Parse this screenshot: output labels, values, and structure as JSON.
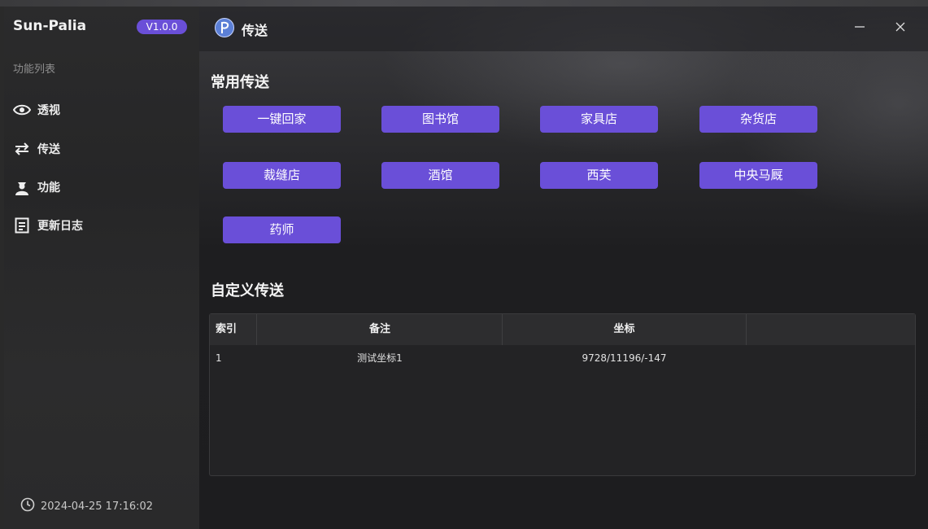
{
  "app": {
    "name": "Sun-Palia",
    "version": "V1.0.0"
  },
  "sidebar": {
    "section_label": "功能列表",
    "items": [
      {
        "label": "透视",
        "icon": "eye-icon"
      },
      {
        "label": "传送",
        "icon": "swap-arrows-icon"
      },
      {
        "label": "功能",
        "icon": "person-icon"
      },
      {
        "label": "更新日志",
        "icon": "document-icon"
      }
    ],
    "clock": "2024-04-25 17:16:02"
  },
  "header": {
    "title": "传送",
    "logo_icon": "palia-logo-icon"
  },
  "common_teleport": {
    "heading": "常用传送",
    "buttons": [
      "一键回家",
      "图书馆",
      "家具店",
      "杂货店",
      "裁缝店",
      "酒馆",
      "西芙",
      "中央马厩",
      "药师"
    ]
  },
  "custom_teleport": {
    "heading": "自定义传送",
    "columns": [
      "索引",
      "备注",
      "坐标",
      ""
    ],
    "rows": [
      {
        "index": "1",
        "note": "测试坐标1",
        "coords": "9728/11196/-147"
      }
    ]
  },
  "colors": {
    "accent": "#6a4fd8",
    "background": "#202022"
  }
}
